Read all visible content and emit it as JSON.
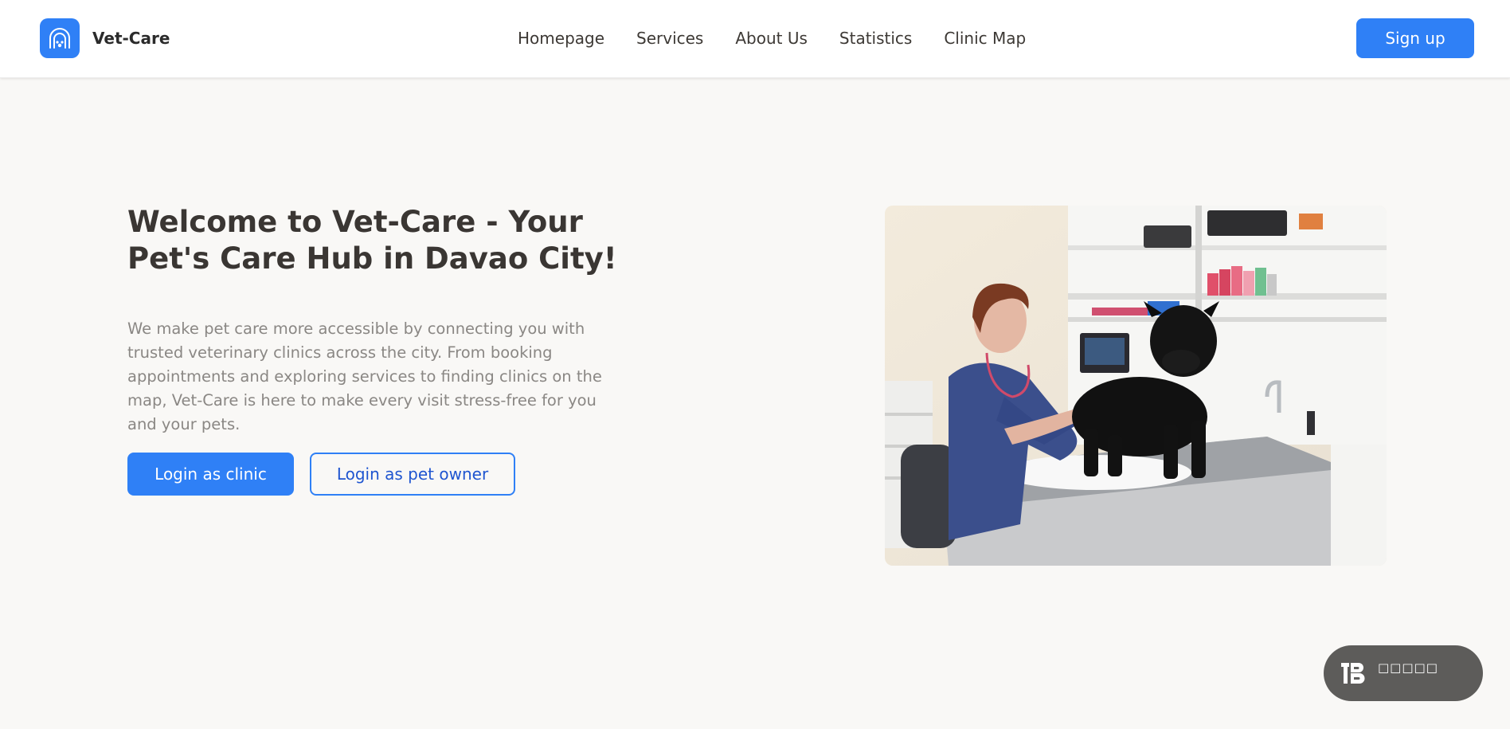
{
  "brand": {
    "name": "Vet-Care",
    "logo_icon": "vet-arch-paw-icon",
    "accent_color": "#2f80f6"
  },
  "nav": {
    "links": [
      {
        "label": "Homepage"
      },
      {
        "label": "Services"
      },
      {
        "label": "About Us"
      },
      {
        "label": "Statistics"
      },
      {
        "label": "Clinic Map"
      }
    ],
    "signup_label": "Sign up"
  },
  "hero": {
    "title": "Welcome to Vet-Care - Your Pet's Care Hub in Davao City!",
    "description": "We make pet care more accessible by connecting you with trusted veterinary clinics across the city. From booking appointments and exploring services to finding clinics on the map, Vet-Care is here to make every visit stress-free for you and your pets.",
    "login_clinic_label": "Login as clinic",
    "login_owner_label": "Login as pet owner",
    "image_icon": "vet-with-pug-photo"
  },
  "floating_widget": {
    "icon": "b-logo-icon",
    "label": "□□□□□"
  }
}
